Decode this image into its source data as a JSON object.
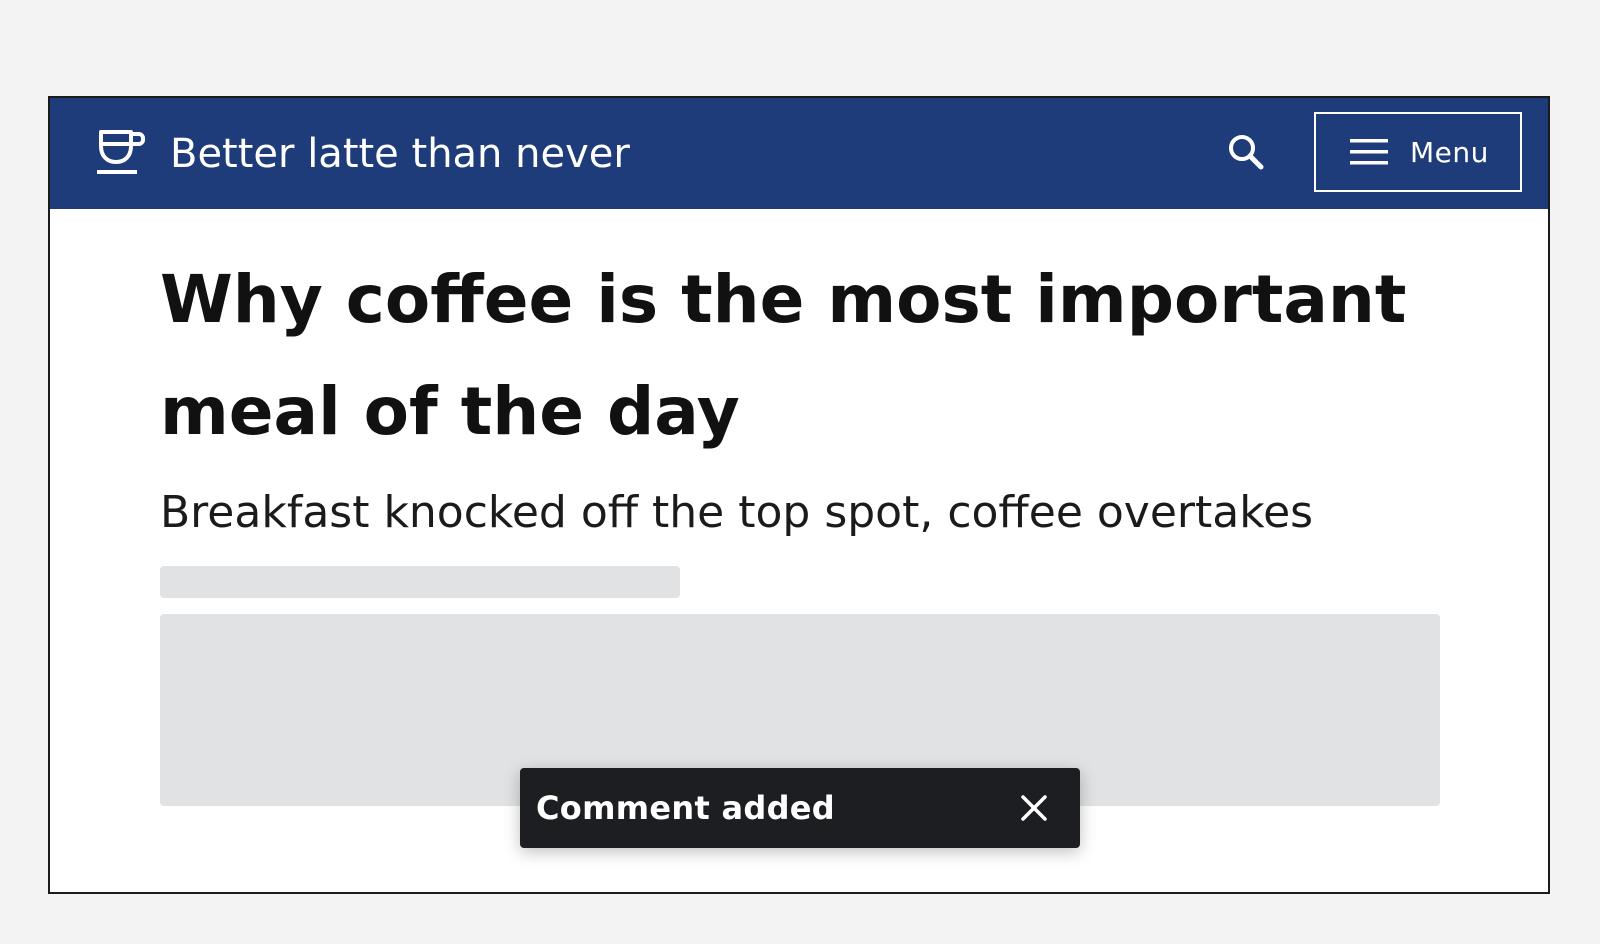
{
  "header": {
    "brand_name": "Better latte than never",
    "logo_icon": "coffee-cup-icon",
    "search_icon": "search-icon",
    "menu_label": "Menu",
    "menu_icon": "hamburger-icon",
    "background_color": "#1f3c7a"
  },
  "article": {
    "title": "Why coffee is the most important meal of the day",
    "subtitle": "Breakfast knocked off the top spot, coffee overtakes"
  },
  "toast": {
    "message": "Comment added",
    "close_icon": "close-icon",
    "background_color": "#1c1e21"
  }
}
